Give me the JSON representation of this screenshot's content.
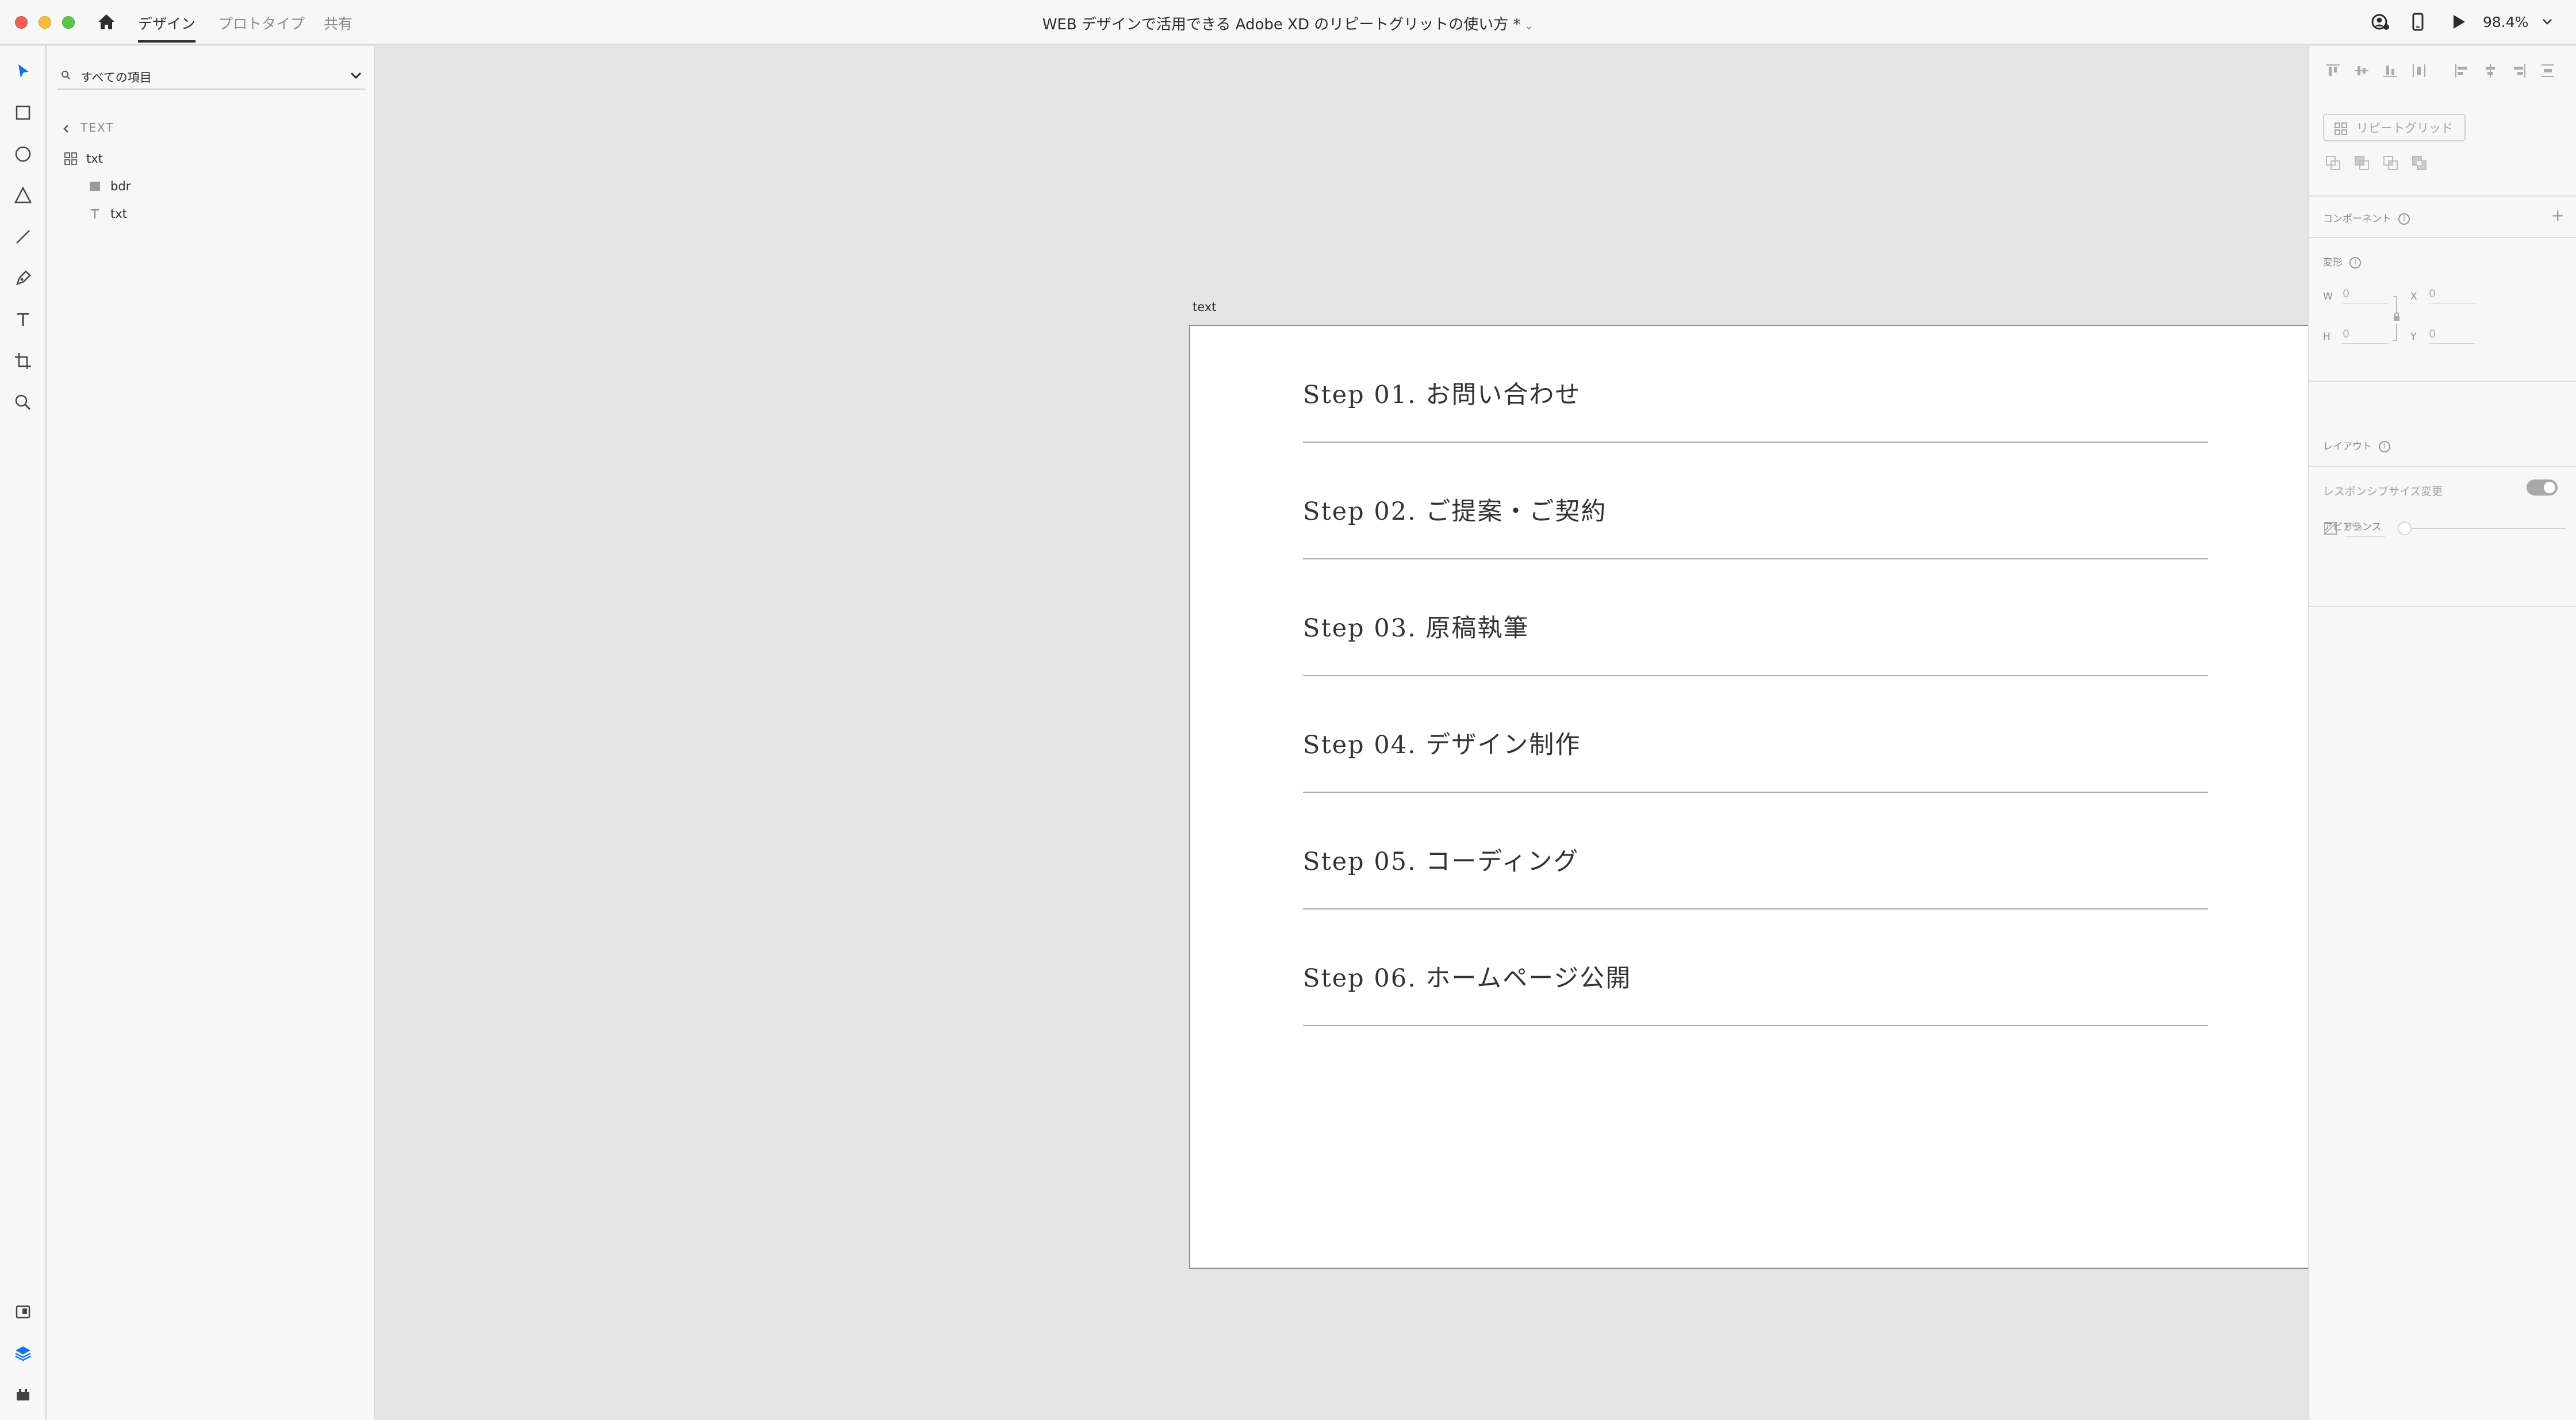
{
  "top_bar": {
    "tabs": [
      "デザイン",
      "プロトタイプ",
      "共有"
    ],
    "document_title": "WEB デザインで活用できる Adobe XD のリピートグリットの使い方 *",
    "zoom": "98.4%"
  },
  "layers_panel": {
    "search_label": "すべての項目",
    "breadcrumb": "TEXT",
    "layers": [
      {
        "name": "txt",
        "type": "repeat-grid",
        "level": 0
      },
      {
        "name": "bdr",
        "type": "rectangle",
        "level": 1
      },
      {
        "name": "txt",
        "type": "text",
        "level": 1
      }
    ]
  },
  "canvas": {
    "artboard_name": "text",
    "items": [
      "Step 01. お問い合わせ",
      "Step 02. ご提案・ご契約",
      "Step 03. 原稿執筆",
      "Step 04. デザイン制作",
      "Step 05. コーディング",
      "Step 06. ホームページ公開"
    ]
  },
  "property_panel": {
    "repeat_grid_button": "リピートグリッド",
    "component_label": "コンポーネント",
    "transform_label": "変形",
    "w_label": "W",
    "w_value": "0",
    "x_label": "X",
    "x_value": "0",
    "h_label": "H",
    "h_value": "0",
    "y_label": "Y",
    "y_value": "0",
    "layout_label": "レイアウト",
    "responsive_label": "レスポンシブサイズ変更",
    "appearance_label": "アピアランス",
    "opacity_value": "0%"
  }
}
